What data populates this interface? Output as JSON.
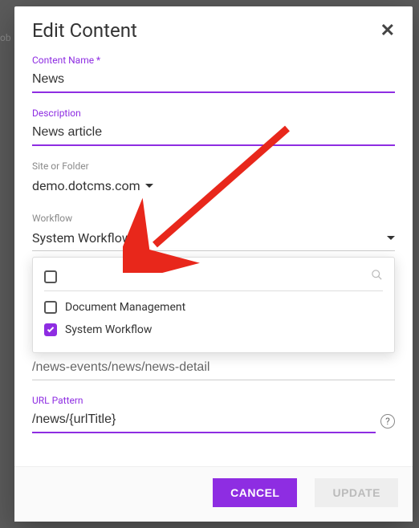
{
  "background": {
    "truncated_text": "ob"
  },
  "modal": {
    "title": "Edit Content",
    "fields": {
      "name": {
        "label": "Content Name *",
        "value": "News"
      },
      "description": {
        "label": "Description",
        "value": "News article"
      },
      "site": {
        "label": "Site or Folder",
        "value": "demo.dotcms.com"
      },
      "workflow": {
        "label": "Workflow",
        "value": "System Workflow",
        "options": [
          {
            "label": "Document Management",
            "checked": false
          },
          {
            "label": "System Workflow",
            "checked": true
          }
        ]
      },
      "detail_page": {
        "value": "/news-events/news/news-detail"
      },
      "url_pattern": {
        "label": "URL Pattern",
        "value": "/news/{urlTitle}"
      }
    },
    "buttons": {
      "cancel": "CANCEL",
      "update": "UPDATE"
    }
  }
}
